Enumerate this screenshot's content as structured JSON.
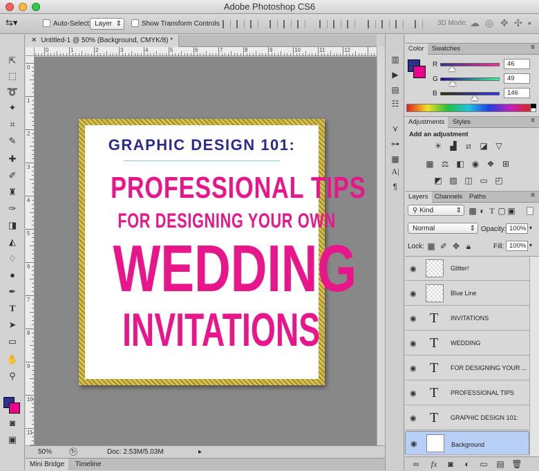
{
  "app": {
    "title": "Adobe Photoshop CS6"
  },
  "options": {
    "auto_select_label": "Auto-Select:",
    "auto_select_value": "Layer",
    "show_transform_label": "Show Transform Controls",
    "mode_3d_label": "3D Mode:"
  },
  "document": {
    "tab_title": "Untitled-1 @ 50% (Background, CMYK/8) *",
    "zoom": "50%",
    "doc_size": "Doc: 2.53M/5.03M",
    "ruler_numbers": [
      "1",
      "0",
      "1",
      "2",
      "3",
      "4",
      "5",
      "6",
      "7",
      "8",
      "9",
      "10",
      "11",
      "12"
    ],
    "vruler_numbers": [
      "0",
      "1",
      "2",
      "3",
      "4",
      "5",
      "6",
      "7",
      "8",
      "9",
      "10",
      "11"
    ],
    "artwork": {
      "line1": "GRAPHIC DESIGN 101:",
      "line2": "PROFESSIONAL TIPS",
      "line3": "FOR DESIGNING YOUR OWN",
      "line4": "WEDDING",
      "line5": "INVITATIONS",
      "navy": "#2b2a8a",
      "pink": "#e8168b",
      "line_color": "#8fc8e0"
    }
  },
  "bottom_tabs": [
    "Mini Bridge",
    "Timeline"
  ],
  "color_panel": {
    "tabs": [
      "Color",
      "Swatches"
    ],
    "r_label": "R",
    "r_value": "46",
    "g_label": "G",
    "g_value": "49",
    "b_label": "B",
    "b_value": "146",
    "fg_color": "#2e3192",
    "bg_color": "#ec008c"
  },
  "adjustments_panel": {
    "tabs": [
      "Adjustments",
      "Styles"
    ],
    "heading": "Add an adjustment"
  },
  "layers_panel": {
    "tabs": [
      "Layers",
      "Channels",
      "Paths"
    ],
    "kind_label": "Kind",
    "blend_mode": "Normal",
    "opacity_label": "Opacity:",
    "opacity_value": "100%",
    "lock_label": "Lock:",
    "fill_label": "Fill:",
    "fill_value": "100%",
    "layers": [
      {
        "name": "Glitter!",
        "type": "raster"
      },
      {
        "name": "Blue Line",
        "type": "raster"
      },
      {
        "name": "INVITATIONS",
        "type": "text"
      },
      {
        "name": "WEDDING",
        "type": "text"
      },
      {
        "name": "FOR DESIGNING YOUR ...",
        "type": "text"
      },
      {
        "name": "PROFESSIONAL TIPS",
        "type": "text"
      },
      {
        "name": "GRAPHIC DESIGN 101:",
        "type": "text"
      },
      {
        "name": "Background",
        "type": "background",
        "selected": true
      }
    ]
  }
}
